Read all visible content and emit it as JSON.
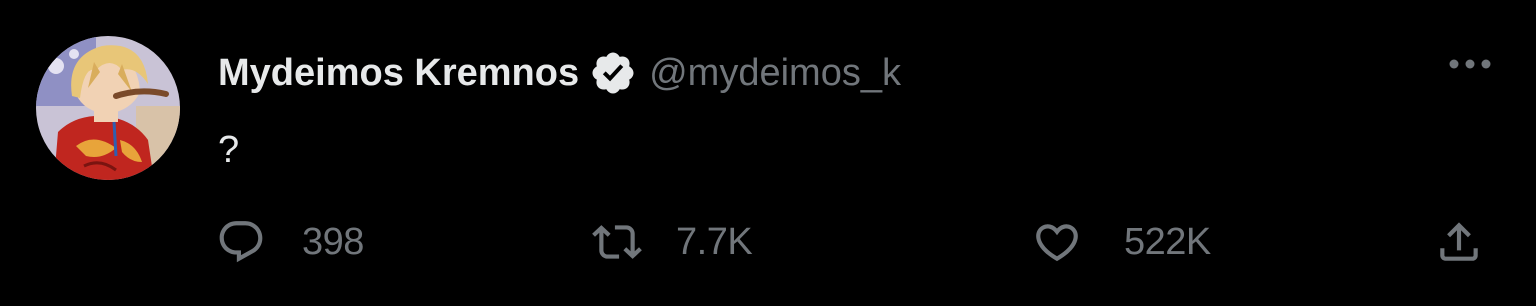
{
  "tweet": {
    "display_name": "Mydeimos Kremnos",
    "handle": "@mydeimos_k",
    "verified": true,
    "text": "?",
    "avatar": {
      "icon": "user-avatar",
      "colors": {
        "background": "#c9c3d6",
        "hair": "#e8c678",
        "outfit": "#c0261f",
        "skin": "#f1d2b4"
      }
    },
    "more_icon": "more-horizontal-icon"
  },
  "actions": {
    "reply": {
      "icon": "reply-icon",
      "count": "398"
    },
    "retweet": {
      "icon": "retweet-icon",
      "count": "7.7K"
    },
    "like": {
      "icon": "heart-icon",
      "count": "522K"
    },
    "share": {
      "icon": "share-icon"
    }
  },
  "theme": {
    "background": "#000000",
    "text_primary": "#e7e9ea",
    "text_secondary": "#71767b",
    "verified_badge": "#e7e9ea"
  }
}
